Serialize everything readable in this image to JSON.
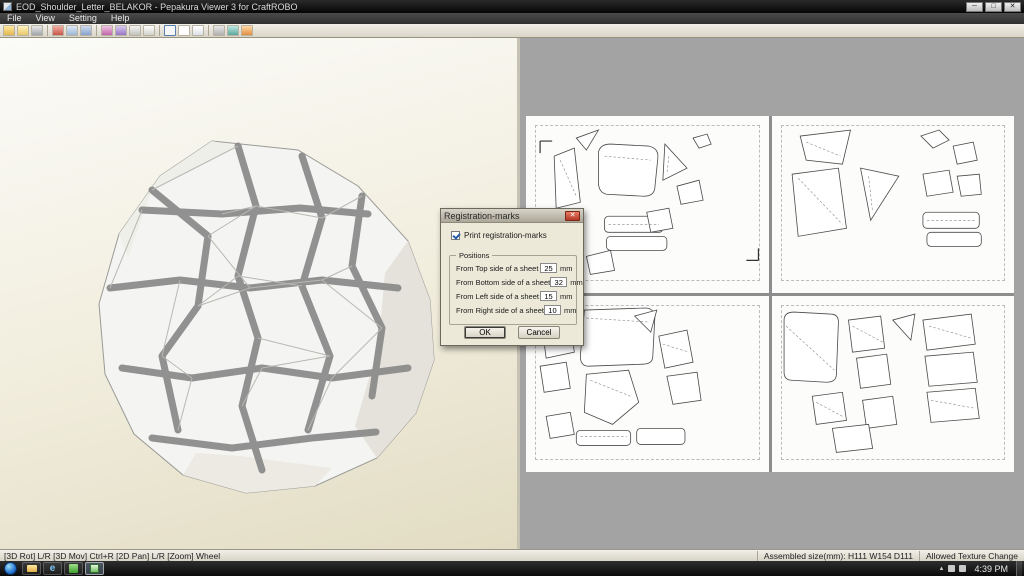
{
  "window": {
    "title": "EOD_Shoulder_Letter_BELAKOR - Pepakura Viewer 3 for CraftROBO",
    "controls": [
      {
        "name": "minimize",
        "glyph": "─"
      },
      {
        "name": "maximize",
        "glyph": "□"
      },
      {
        "name": "close",
        "glyph": "✕"
      }
    ]
  },
  "menu": {
    "items": [
      "File",
      "View",
      "Setting",
      "Help"
    ]
  },
  "toolbar": {
    "icons": [
      "open",
      "import",
      "print",
      "settings",
      "copy",
      "export",
      "texture",
      "palette",
      "view-3d",
      "view-2d",
      "zoom",
      "fit",
      "window-box",
      "select",
      "measure",
      "pen"
    ]
  },
  "dialog": {
    "title": "Registration-marks",
    "close_glyph": "✕",
    "checkbox_label": "Print registration-marks",
    "checkbox_checked": true,
    "group_label": "Positions",
    "fields": [
      {
        "label": "From Top side of a sheet",
        "value": "25",
        "unit": "mm"
      },
      {
        "label": "From Bottom side of a sheet",
        "value": "32",
        "unit": "mm"
      },
      {
        "label": "From Left side of a sheet",
        "value": "15",
        "unit": "mm"
      },
      {
        "label": "From Right side of a sheet",
        "value": "10",
        "unit": "mm"
      }
    ],
    "buttons": {
      "ok": "OK",
      "cancel": "Cancel"
    }
  },
  "status": {
    "hint": "[3D Rot] L/R [3D Mov] Ctrl+R [2D Pan] L/R [Zoom] Wheel",
    "assembled_size": "Assembled size(mm): H111 W154 D111",
    "texture": "Allowed Texture Change"
  },
  "taskbar": {
    "time": "4:39 PM",
    "tray_expand": "▲",
    "items": [
      {
        "name": "explorer"
      },
      {
        "name": "internet-explorer",
        "glyph": "e"
      },
      {
        "name": "media-app"
      },
      {
        "name": "pepakura-viewer",
        "active": true
      }
    ]
  }
}
